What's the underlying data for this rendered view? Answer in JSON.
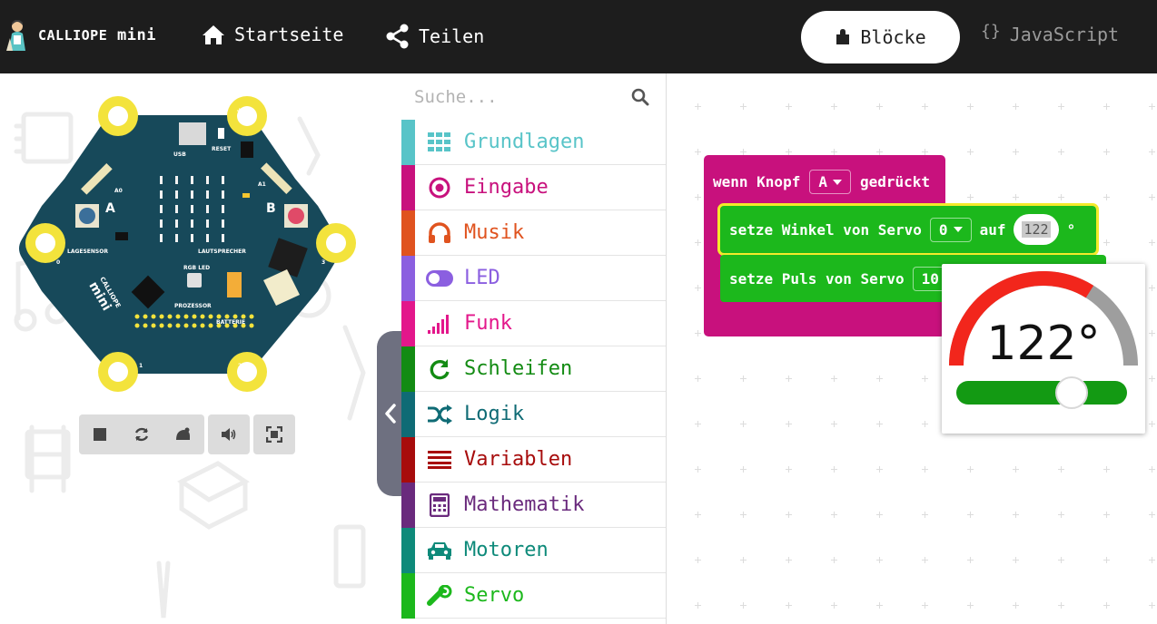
{
  "header": {
    "brand_calliope": "CALLIOPE",
    "brand_mini": "mini",
    "nav_home": "Startseite",
    "nav_share": "Teilen",
    "blocks_label": "Blöcke",
    "js_braces": "{}",
    "js_label": "JavaScript"
  },
  "simulator": {
    "board_labels": {
      "minus": "-",
      "plus": "+",
      "usb": "USB",
      "reset": "RESET",
      "a0": "A0",
      "a1": "A1",
      "button_a": "A",
      "button_b": "B",
      "lagesensor": "LAGESENSOR",
      "lautsprecher": "LAUTSPRECHER",
      "rgb_led": "RGB LED",
      "prozessor": "PROZESSOR",
      "batterie": "BATTERIE",
      "logo_calliope": "CALLIOPE",
      "logo_mini": "mini",
      "pin0": "0",
      "pin1": "1",
      "pin2": "2",
      "pin3": "3"
    },
    "controls": [
      "stop-icon",
      "restart-icon",
      "slow-mo-icon",
      "mute-icon",
      "fullscreen-icon"
    ]
  },
  "toolbox": {
    "search_placeholder": "Suche...",
    "categories": [
      {
        "label": "Grundlagen",
        "color": "#58c4c8",
        "icon": "grid-icon"
      },
      {
        "label": "Eingabe",
        "color": "#c8117d",
        "icon": "target-icon"
      },
      {
        "label": "Musik",
        "color": "#e0531f",
        "icon": "headphones-icon"
      },
      {
        "label": "LED",
        "color": "#8b5fe0",
        "icon": "toggle-icon"
      },
      {
        "label": "Funk",
        "color": "#e3178b",
        "icon": "signal-bars-icon"
      },
      {
        "label": "Schleifen",
        "color": "#138b13",
        "icon": "loop-icon"
      },
      {
        "label": "Logik",
        "color": "#0f6b75",
        "icon": "shuffle-icon"
      },
      {
        "label": "Variablen",
        "color": "#a70c0c",
        "icon": "list-lines-icon"
      },
      {
        "label": "Mathematik",
        "color": "#6a2a7d",
        "icon": "calculator-icon"
      },
      {
        "label": "Motoren",
        "color": "#0e8a7a",
        "icon": "car-icon"
      },
      {
        "label": "Servo",
        "color": "#1cb81c",
        "icon": "servo-icon"
      }
    ]
  },
  "workspace": {
    "event_block": {
      "prefix": "wenn Knopf",
      "button_value": "A",
      "suffix": "gedrückt",
      "color": "#c8117d"
    },
    "servo_angle_block": {
      "prefix": "setze Winkel von Servo",
      "servo_value": "0",
      "middle": "auf",
      "angle_value": "122",
      "unit": "°",
      "color": "#1cb81c"
    },
    "servo_pulse_block": {
      "prefix": "setze Puls von Servo",
      "value_partial": "10",
      "color": "#1cb81c"
    },
    "dial": {
      "value_text": "122°",
      "value": 122,
      "min": 0,
      "max": 180,
      "arc_active_color": "#f2261c",
      "arc_inactive_color": "#9e9e9e",
      "slider_color": "#139a13"
    }
  }
}
